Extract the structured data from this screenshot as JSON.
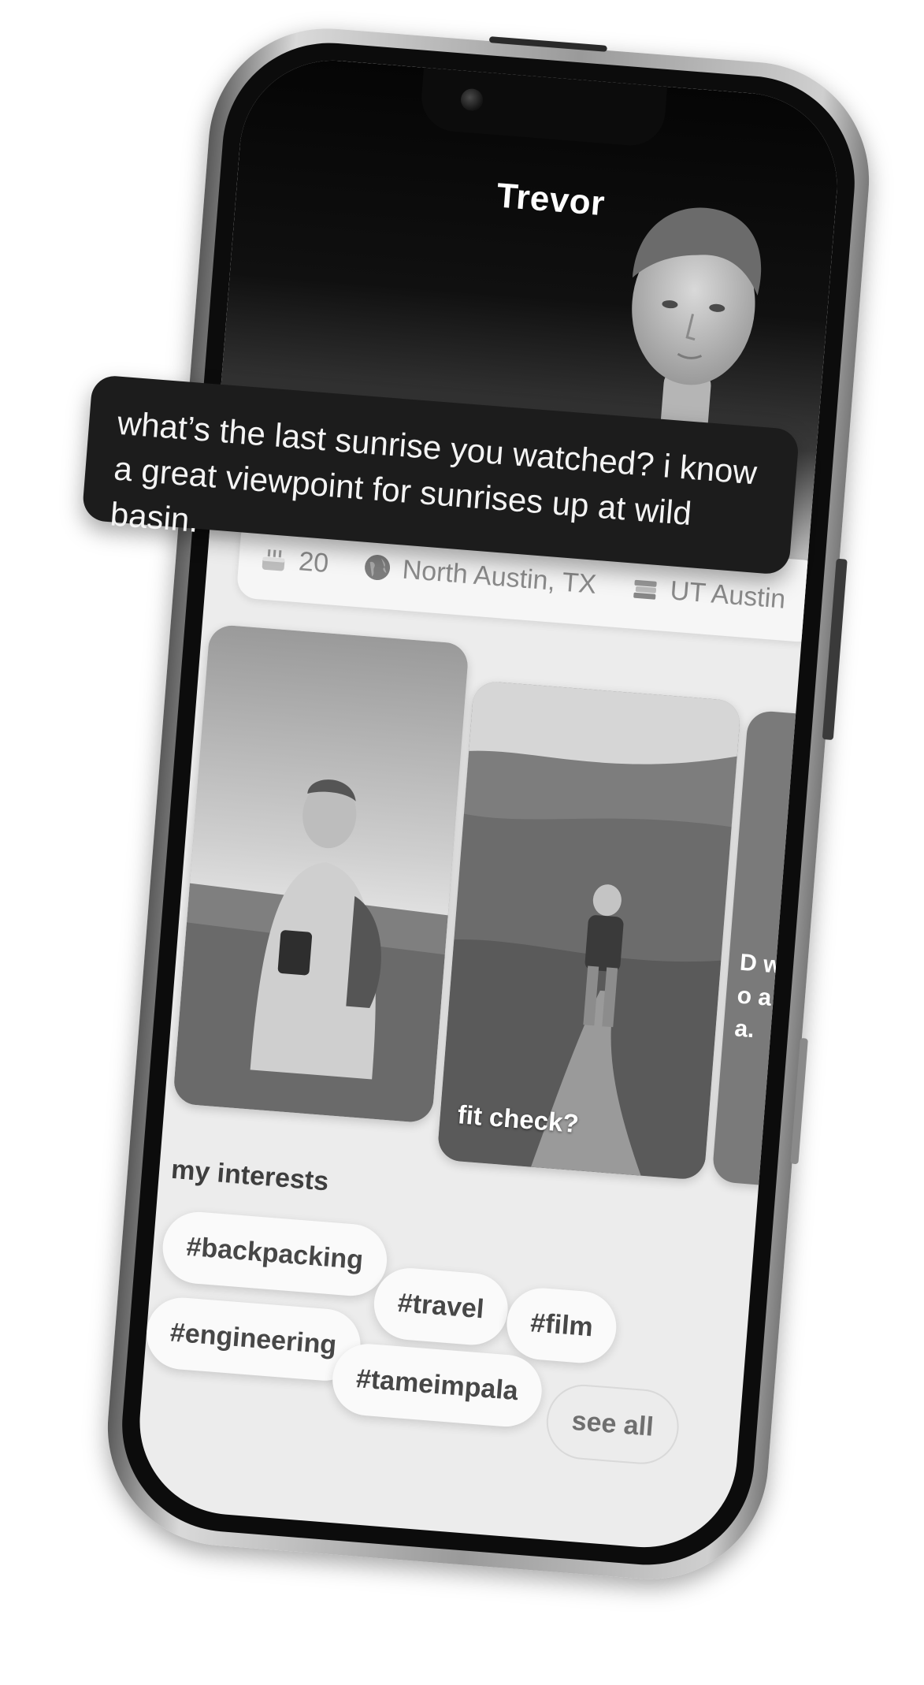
{
  "profile": {
    "name": "Trevor"
  },
  "prompt_bubble": {
    "text": "what’s the last sunrise you watched? i know a great viewpoint for sunrises up at wild basin."
  },
  "stats": [
    {
      "icon": "birthday-cake-icon",
      "text": "20"
    },
    {
      "icon": "globe-icon",
      "text": "North Austin, TX"
    },
    {
      "icon": "books-icon",
      "text": "UT Austin"
    }
  ],
  "photos": [
    {
      "caption": ""
    },
    {
      "caption": "fit check?"
    },
    {
      "caption": "D w o a a."
    }
  ],
  "interests": {
    "title": "my interests",
    "tags": [
      "#backpacking",
      "#travel",
      "#film",
      "#engineering",
      "#tameimpala"
    ],
    "see_all_label": "see all"
  }
}
